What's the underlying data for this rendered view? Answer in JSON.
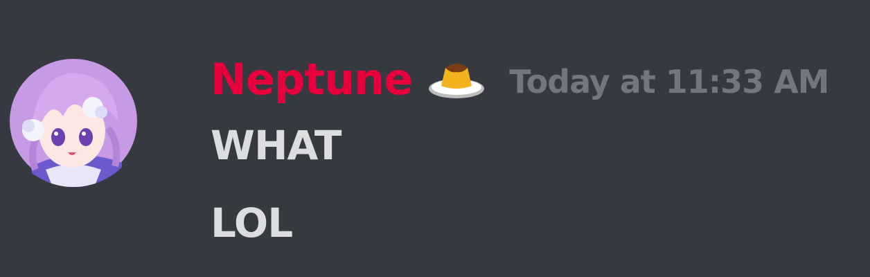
{
  "message": {
    "author": {
      "name": "Neptune",
      "name_color": "#e8003d",
      "avatar_icon": "anime-girl-avatar",
      "role_icon": "pudding-icon"
    },
    "timestamp": "Today at 11:33 AM",
    "lines": [
      "WHAT",
      "LOL"
    ]
  },
  "colors": {
    "background": "#36393f",
    "message_text": "#dcddde",
    "timestamp_text": "#72767d"
  }
}
